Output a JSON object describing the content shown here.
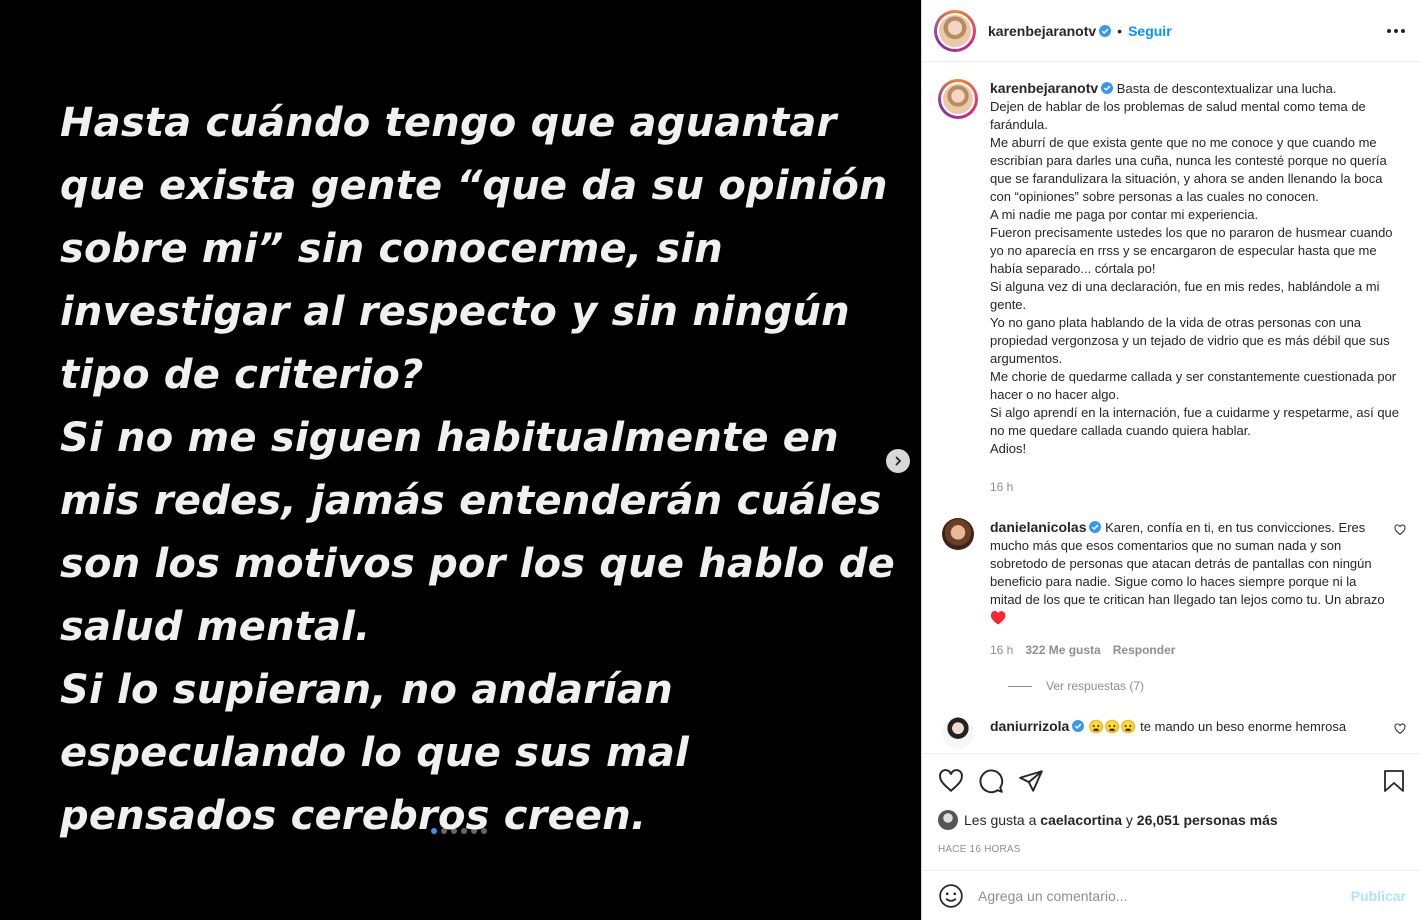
{
  "media": {
    "paragraphs": [
      "Hasta cuándo tengo que aguantar que exista gente “que da su opinión sobre mi” sin conocerme, sin investigar al respecto y sin ningún tipo de criterio?",
      "Si no me siguen habitualmente en mis redes, jamás entenderán cuáles son los motivos por los que hablo de salud mental.",
      "Si lo supieran, no andarían especulando lo que sus mal pensados cerebros creen."
    ],
    "carousel_total": 6,
    "carousel_active": 1
  },
  "header": {
    "username": "karenbejaranotv",
    "separator": "•",
    "follow_label": "Seguir"
  },
  "caption": {
    "username": "karenbejaranotv",
    "lines": [
      "Basta de descontextualizar una lucha.",
      "Dejen de hablar de los problemas de salud mental como tema de farándula.",
      "Me aburrí de que exista gente que no me conoce y que cuando me escribían para darles una cuña, nunca les contesté porque no quería que se farandulizara la situación, y ahora se anden llenando la boca con “opiniones” sobre personas a las cuales no conocen.",
      "A mi nadie me paga por contar mi experiencia.",
      "Fueron precisamente ustedes los que no pararon de husmear cuando yo no aparecía en rrss y se encargaron de especular hasta que me había separado... córtala po!",
      "Si alguna vez di una declaración, fue en mis redes, hablándole a mi gente.",
      "Yo no gano plata hablando de la vida de otras personas con una propiedad vergonzosa y un tejado de vidrio que es más débil que sus argumentos.",
      "Me chorie de quedarme callada y ser constantemente cuestionada por hacer o no hacer algo.",
      "Si algo aprendí en la internación, fue a cuidarme y respetarme, así que no me quedare callada cuando quiera hablar.",
      "Adios!"
    ],
    "time": "16 h"
  },
  "comments": [
    {
      "username": "danielanicolas",
      "text": "Karen, confía en ti, en tus convicciones. Eres mucho más que esos comentarios que no suman nada y son sobretodo de personas que atacan detrás de pantallas con ningún beneficio para nadie. Sigue como lo haces siempre porque ni la mitad de los que te critican han llegado tan lejos como tu. Un abrazo ♥️",
      "time": "16 h",
      "likes": "322 Me gusta",
      "reply_label": "Responder",
      "view_replies": "Ver respuestas (7)"
    },
    {
      "username": "daniurrizola",
      "text": "😦😦😦 te mando un beso enorme hemrosa"
    }
  ],
  "likes": {
    "prefix": "Les gusta a",
    "user": "caelacortina",
    "connector": "y",
    "others": "26,051 personas más"
  },
  "posted_ago": "HACE 16 HORAS",
  "add_comment": {
    "placeholder": "Agrega un comentario...",
    "publish_label": "Publicar"
  },
  "colors": {
    "accent": "#0095f6",
    "verified": "#3897f0",
    "publish_disabled": "#b2dffc"
  }
}
